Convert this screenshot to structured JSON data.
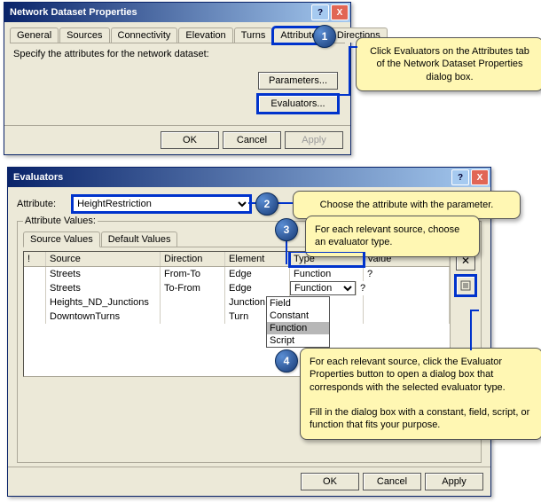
{
  "dialog1": {
    "title": "Network Dataset Properties",
    "tabs": [
      "General",
      "Sources",
      "Connectivity",
      "Elevation",
      "Turns",
      "Attributes",
      "Directions"
    ],
    "active_tab_index": 5,
    "specify_text": "Specify the attributes for the network dataset:",
    "parameters_btn": "Parameters...",
    "evaluators_btn": "Evaluators...",
    "ok": "OK",
    "cancel": "Cancel",
    "apply": "Apply"
  },
  "dialog2": {
    "title": "Evaluators",
    "attribute_label": "Attribute:",
    "attribute_value": "HeightRestriction",
    "fieldset_label": "Attribute Values:",
    "tabs": [
      "Source Values",
      "Default Values"
    ],
    "active_tab_index": 0,
    "columns": {
      "flag": "!",
      "source": "Source",
      "direction": "Direction",
      "element": "Element",
      "type": "Type",
      "value": "Value"
    },
    "rows": [
      {
        "source": "Streets",
        "direction": "From-To",
        "element": "Edge",
        "type": "Function",
        "value": "?"
      },
      {
        "source": "Streets",
        "direction": "To-From",
        "element": "Edge",
        "type": "Function",
        "value": "?"
      },
      {
        "source": "Heights_ND_Junctions",
        "direction": "",
        "element": "Junction",
        "type": "",
        "value": ""
      },
      {
        "source": "DowntownTurns",
        "direction": "",
        "element": "Turn",
        "type": "",
        "value": ""
      }
    ],
    "type_options": [
      "Field",
      "Constant",
      "Function",
      "Script"
    ],
    "type_selected_index": 2,
    "ok": "OK",
    "cancel": "Cancel",
    "apply": "Apply"
  },
  "callouts": {
    "c1": "Click Evaluators on the Attributes tab of the Network Dataset Properties dialog box.",
    "c2": "Choose the attribute with the parameter.",
    "c3": "For each relevant source, choose an evaluator type.",
    "c4": "For each relevant source, click the Evaluator Properties button to open a dialog box that corresponds with the selected evaluator type.\n\nFill in the dialog box with a constant, field, script, or function that fits your purpose."
  },
  "steps": {
    "s1": "1",
    "s2": "2",
    "s3": "3",
    "s4": "4"
  }
}
